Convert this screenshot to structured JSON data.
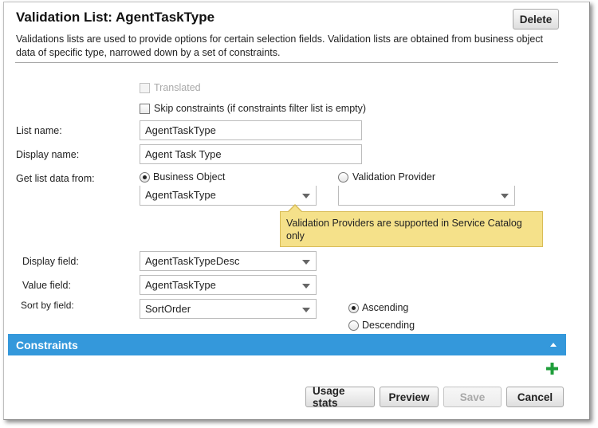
{
  "header": {
    "title": "Validation List: AgentTaskType",
    "delete_label": "Delete",
    "description": "Validations lists are used to provide options for certain selection fields. Validation lists are obtained from business object data of specific type, narrowed down by a set of constraints."
  },
  "form": {
    "translated_label": "Translated",
    "skip_constraints_label": "Skip constraints (if constraints filter list is empty)",
    "list_name_label": "List name:",
    "list_name_value": "AgentTaskType",
    "display_name_label": "Display name:",
    "display_name_value": "Agent Task Type",
    "get_list_label": "Get list data from:",
    "business_object_label": "Business Object",
    "business_object_value": "AgentTaskType",
    "validation_provider_label": "Validation Provider",
    "validation_provider_value": "",
    "tooltip": "Validation Providers are supported in Service Catalog only",
    "display_field_label": "Display field:",
    "display_field_value": "AgentTaskTypeDesc",
    "value_field_label": "Value field:",
    "value_field_value": "AgentTaskType",
    "sort_by_label": "Sort by field:",
    "sort_by_value": "SortOrder",
    "ascending_label": "Ascending",
    "descending_label": "Descending"
  },
  "constraints": {
    "title": "Constraints"
  },
  "footer": {
    "usage_stats_label": "Usage stats",
    "preview_label": "Preview",
    "save_label": "Save",
    "cancel_label": "Cancel"
  },
  "colors": {
    "section_bar": "#3498db",
    "tooltip_bg": "#f5e18a",
    "add_icon": "#1e9e3a"
  },
  "icons": {
    "add": "plus-icon",
    "collapse": "chevron-up-icon",
    "dropdown": "chevron-down-icon"
  }
}
